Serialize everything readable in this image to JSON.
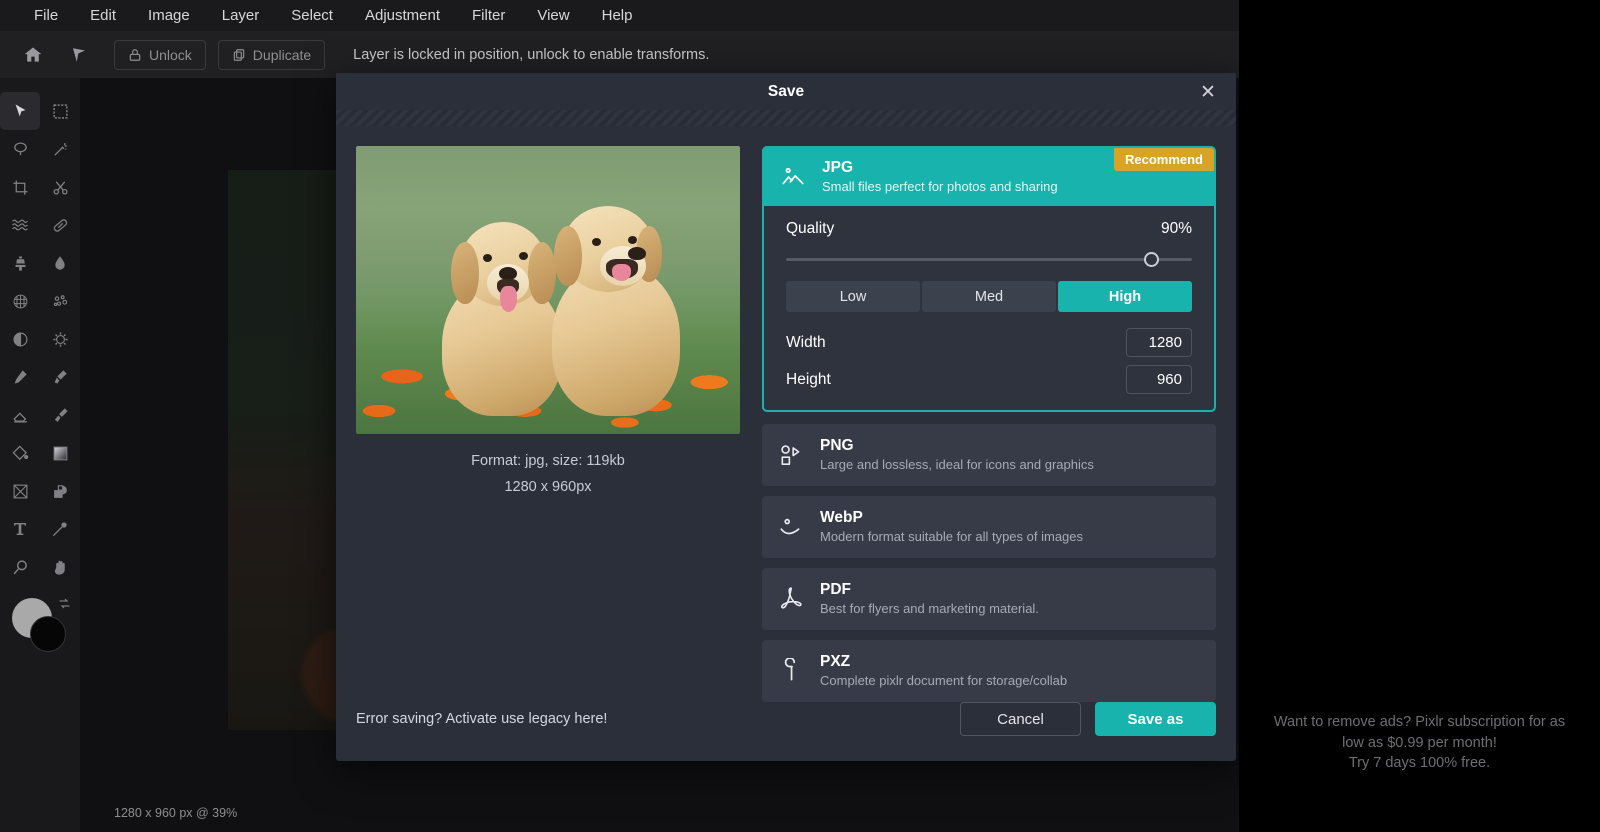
{
  "menubar": {
    "items": [
      {
        "label": "File"
      },
      {
        "label": "Edit"
      },
      {
        "label": "Image"
      },
      {
        "label": "Layer"
      },
      {
        "label": "Select"
      },
      {
        "label": "Adjustment"
      },
      {
        "label": "Filter"
      },
      {
        "label": "View"
      },
      {
        "label": "Help"
      }
    ]
  },
  "topbar": {
    "unlock_label": "Unlock",
    "duplicate_label": "Duplicate",
    "message": "Layer is locked in position, unlock to enable transforms."
  },
  "canvas": {
    "status": "1280 x 960 px @ 39%"
  },
  "ad": {
    "line1": "Want to remove ads? Pixlr subscription for as",
    "line2": "low as $0.99 per month!",
    "line3": "Try 7 days 100% free."
  },
  "dialog": {
    "title": "Save",
    "close_label": "✕",
    "preview": {
      "format_line": "Format: jpg, size: 119kb",
      "dimension_line": "1280 x 960px"
    },
    "jpg": {
      "name": "JPG",
      "desc": "Small files perfect for photos and sharing",
      "badge": "Recommend",
      "quality_label": "Quality",
      "quality_value": "90%",
      "quality_percent": 90,
      "presets": [
        {
          "label": "Low",
          "active": false
        },
        {
          "label": "Med",
          "active": false
        },
        {
          "label": "High",
          "active": true
        }
      ],
      "width_label": "Width",
      "width_value": "1280",
      "height_label": "Height",
      "height_value": "960"
    },
    "formats": [
      {
        "name": "PNG",
        "desc": "Large and lossless, ideal for icons and graphics",
        "icon": "png-shapes-icon"
      },
      {
        "name": "WebP",
        "desc": "Modern format suitable for all types of images",
        "icon": "webp-curve-icon"
      },
      {
        "name": "PDF",
        "desc": "Best for flyers and marketing material.",
        "icon": "pdf-acrobat-icon"
      },
      {
        "name": "PXZ",
        "desc": "Complete pixlr document for storage/collab",
        "icon": "pxz-icon"
      }
    ],
    "footer": {
      "legacy_text": "Error saving? Activate use legacy here!",
      "cancel_label": "Cancel",
      "save_label": "Save as"
    }
  },
  "colors": {
    "accent": "#17b3ac",
    "badge": "#d9a326",
    "dialog_bg": "#2b2f3a",
    "card_bg": "#363b47"
  }
}
